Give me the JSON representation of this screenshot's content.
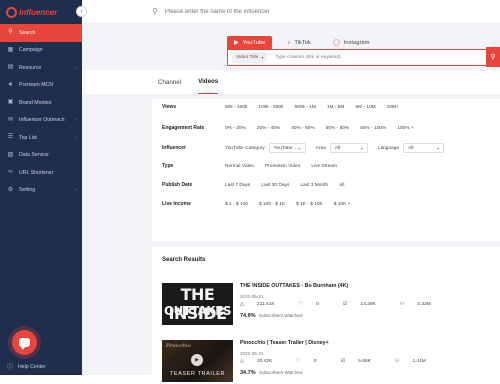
{
  "brand": {
    "logo_text": "influencer",
    "accent": "#e8453c",
    "sidebar_bg": "#1f2d4e"
  },
  "sidebar": {
    "items": [
      {
        "label": "Search",
        "icon": "search-icon",
        "active": true
      },
      {
        "label": "Campaign",
        "icon": "campaign-icon"
      },
      {
        "label": "Resource",
        "icon": "resource-icon",
        "chevron": true
      },
      {
        "label": "Premium MCN",
        "icon": "premium-icon"
      },
      {
        "label": "Brand Monitor",
        "icon": "monitor-icon"
      },
      {
        "label": "Influencer Outreach",
        "icon": "outreach-icon",
        "chevron": true
      },
      {
        "label": "Top List",
        "icon": "toplist-icon",
        "chevron": true
      },
      {
        "label": "Data Service",
        "icon": "data-icon"
      },
      {
        "label": "URL Shortener",
        "icon": "link-icon"
      },
      {
        "label": "Setting",
        "icon": "gear-icon",
        "chevron": true
      }
    ],
    "help_center": "Help Center"
  },
  "topbar": {
    "search_placeholder": "Please enter the name of the influencer"
  },
  "platforms": [
    {
      "label": "YouTube",
      "icon": "youtube-icon",
      "active": true
    },
    {
      "label": "TikTok",
      "icon": "tiktok-icon"
    },
    {
      "label": "Instagram",
      "icon": "instagram-icon"
    }
  ],
  "search": {
    "field_select": "Video Title",
    "placeholder": "Type channel (title or keyword)"
  },
  "content_tabs": [
    {
      "label": "Channel"
    },
    {
      "label": "Videos",
      "active": true
    }
  ],
  "filters": {
    "views": {
      "label": "Views",
      "options": [
        "50k - 100k",
        "100k - 500k",
        "500k - 1M",
        "1M - 5M",
        "5M - 10M",
        "10M+"
      ]
    },
    "engagement": {
      "label": "Engagement Rate",
      "options": [
        "0% - 20%",
        "20% - 40%",
        "40% - 60%",
        "60% - 80%",
        "80% - 100%",
        "100% +"
      ]
    },
    "influencer": {
      "label": "Influencer",
      "category_label": "YouTube Category",
      "category_value": "YouTube ...",
      "area_label": "Area",
      "area_value": "All",
      "language_label": "Language",
      "language_value": "All"
    },
    "type": {
      "label": "Type",
      "options": [
        "Normal Video",
        "Promotion Video",
        "Live Stream"
      ]
    },
    "publish": {
      "label": "Publish Date",
      "options": [
        "Last 7 Days",
        "Last 30 Days",
        "Last 3 Month",
        "All"
      ]
    },
    "income": {
      "label": "Live Income",
      "options": [
        "$ 1 - $ 100",
        "$ 100 - $ 1K",
        "$ 1K - $ 10K",
        "$ 10K +"
      ]
    }
  },
  "results": {
    "heading": "Search Results",
    "items": [
      {
        "title": "THE INSIDE OUTTAKES - Bo Burnham (4K)",
        "date": "2022-05-31",
        "views": "211.41K",
        "comments": "0",
        "likes": "14.28K",
        "subs": "2.32M",
        "watched_pct": "74.9%",
        "watched_label": "Subscribers Watched",
        "thumb_top": "THE INSIDE",
        "thumb_bottom": "OUTTAKES"
      },
      {
        "title": "Pinocchio | Teaser Trailer | Disney+",
        "date": "2022-05-31",
        "views": "20.42K",
        "comments": "0",
        "likes": "5.68K",
        "subs": "1.41M",
        "watched_pct": "34.7%",
        "watched_label": "Subscribers Watched",
        "thumb_top": "Pinocchio",
        "thumb_bottom": "TEASER TRAILER"
      }
    ]
  }
}
